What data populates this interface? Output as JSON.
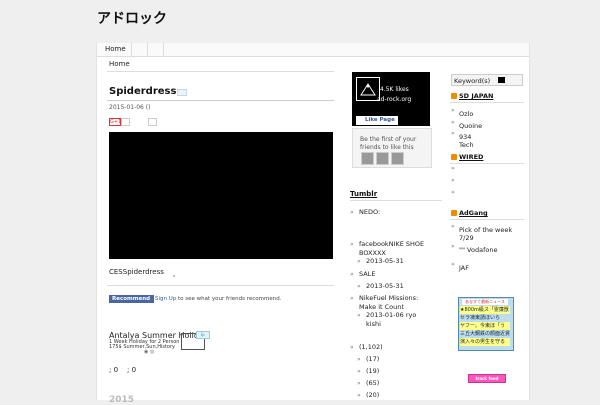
{
  "site": {
    "title": "アドロック"
  },
  "nav": {
    "home": "Home"
  },
  "breadcrumb": "Home",
  "post": {
    "title": "Spiderdress",
    "date": "2015-01-06 ()",
    "share_g": "G+1",
    "text": "CESSpiderdress",
    "text_comma": ",",
    "fb_recommend": "Recommend",
    "fb_signup": "Sign Up",
    "fb_signup_rest": " to see what your friends recommend.",
    "meta_a": "; 0",
    "meta_b": "; 0"
  },
  "ad": {
    "title": "Antalya Summer Holid",
    "line1": "1 Week Holiday for 2 Person",
    "line2": "175$ Summer,Sun,History",
    "dots": "◉ ◎",
    "badge": "i▷"
  },
  "facebook": {
    "likes": "4.5K likes",
    "url": "ad-rock.org",
    "like_button": "Like Page",
    "first": "Be the first of your friends to like this"
  },
  "tumblr": {
    "heading": "Tumblr",
    "items": [
      {
        "label": "NEDO:",
        "indent": false
      },
      {
        "label": "facebookNIKE SHOE BOXXXX",
        "indent": false
      },
      {
        "label": "2013-05-31",
        "indent": true
      },
      {
        "label": "SALE",
        "indent": false
      },
      {
        "label": "2013-05-31",
        "indent": true
      },
      {
        "label": "NikeFuel Missions: Make it Count",
        "indent": false
      },
      {
        "label": "2013-01-06 ryo kishi",
        "indent": true
      }
    ],
    "archive": [
      {
        "label": "(1,102)",
        "indent": false
      },
      {
        "label": "(17)",
        "indent": true
      },
      {
        "label": "(19)",
        "indent": true
      },
      {
        "label": "(65)",
        "indent": true
      },
      {
        "label": "(20)",
        "indent": true
      }
    ]
  },
  "search": {
    "placeholder": "Keyword(s)"
  },
  "feeds": [
    {
      "heading": "SD JAPAN",
      "items": [
        "Ozlo",
        "Quoine",
        "934\nTech"
      ]
    },
    {
      "heading": "WIRED",
      "items": [
        "",
        "",
        ""
      ]
    },
    {
      "heading": "AdGang",
      "items": [
        "Pick of the week\n7/29",
        "\"\" Vodafone",
        "JAF"
      ]
    }
  ],
  "ad_right": {
    "top": "あなすて最新ニュース",
    "lines": [
      "★800m級ス「霊廉獣",
      "セラ凍東請ほいら",
      "ヤフー。今東ほ「う",
      "三丘大鋼鉄の顔面近賃",
      "演入々の男生を守る"
    ]
  },
  "trackfeed": "track feed",
  "post2_title": "2015"
}
